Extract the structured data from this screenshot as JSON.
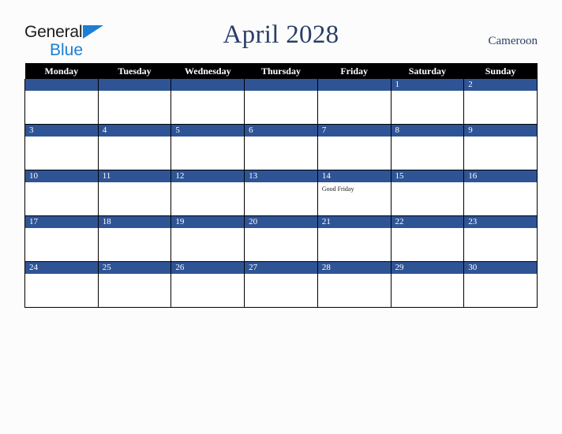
{
  "brand": {
    "name_part1": "General",
    "name_part2": "Blue",
    "triangle_color": "#1b7fd4"
  },
  "header": {
    "title": "April 2028",
    "country": "Cameroon",
    "title_color": "#2a3f66"
  },
  "calendar": {
    "weekday_headers": [
      "Monday",
      "Tuesday",
      "Wednesday",
      "Thursday",
      "Friday",
      "Saturday",
      "Sunday"
    ],
    "header_bg": "#000000",
    "daybar_bg": "#2f5496",
    "daybar_text": "#ffffff",
    "cell_bg": "#ffffff",
    "border_color": "#000000",
    "weeks": [
      [
        {
          "day": "",
          "events": []
        },
        {
          "day": "",
          "events": []
        },
        {
          "day": "",
          "events": []
        },
        {
          "day": "",
          "events": []
        },
        {
          "day": "",
          "events": []
        },
        {
          "day": "1",
          "events": []
        },
        {
          "day": "2",
          "events": []
        }
      ],
      [
        {
          "day": "3",
          "events": []
        },
        {
          "day": "4",
          "events": []
        },
        {
          "day": "5",
          "events": []
        },
        {
          "day": "6",
          "events": []
        },
        {
          "day": "7",
          "events": []
        },
        {
          "day": "8",
          "events": []
        },
        {
          "day": "9",
          "events": []
        }
      ],
      [
        {
          "day": "10",
          "events": []
        },
        {
          "day": "11",
          "events": []
        },
        {
          "day": "12",
          "events": []
        },
        {
          "day": "13",
          "events": []
        },
        {
          "day": "14",
          "events": [
            "Good Friday"
          ]
        },
        {
          "day": "15",
          "events": []
        },
        {
          "day": "16",
          "events": []
        }
      ],
      [
        {
          "day": "17",
          "events": []
        },
        {
          "day": "18",
          "events": []
        },
        {
          "day": "19",
          "events": []
        },
        {
          "day": "20",
          "events": []
        },
        {
          "day": "21",
          "events": []
        },
        {
          "day": "22",
          "events": []
        },
        {
          "day": "23",
          "events": []
        }
      ],
      [
        {
          "day": "24",
          "events": []
        },
        {
          "day": "25",
          "events": []
        },
        {
          "day": "26",
          "events": []
        },
        {
          "day": "27",
          "events": []
        },
        {
          "day": "28",
          "events": []
        },
        {
          "day": "29",
          "events": []
        },
        {
          "day": "30",
          "events": []
        }
      ]
    ]
  }
}
